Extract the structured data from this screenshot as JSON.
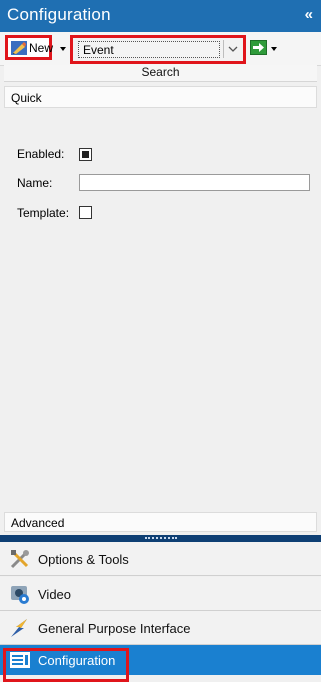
{
  "title_bar": {
    "title": "Configuration",
    "collapse_glyph": "«"
  },
  "toolbar": {
    "new_label": "New",
    "event_value": "Event"
  },
  "search": {
    "label": "Search"
  },
  "quick_panel": {
    "header": "Quick",
    "enabled_label": "Enabled:",
    "enabled_checked": true,
    "name_label": "Name:",
    "name_value": "",
    "template_label": "Template:",
    "template_checked": false
  },
  "advanced_panel": {
    "header": "Advanced"
  },
  "navigation": {
    "items": [
      {
        "label": "Options & Tools",
        "icon": "tools-icon"
      },
      {
        "label": "Video",
        "icon": "video-camera-icon"
      },
      {
        "label": "General Purpose Interface",
        "icon": "lightning-bolt-icon"
      },
      {
        "label": "Configuration",
        "icon": "configuration-list-icon",
        "selected": true
      }
    ]
  },
  "colors": {
    "accent": "#1f6fb2",
    "selected_nav": "#1a80d0",
    "highlight_outline": "#e0151b",
    "splitter": "#0e3f74"
  }
}
